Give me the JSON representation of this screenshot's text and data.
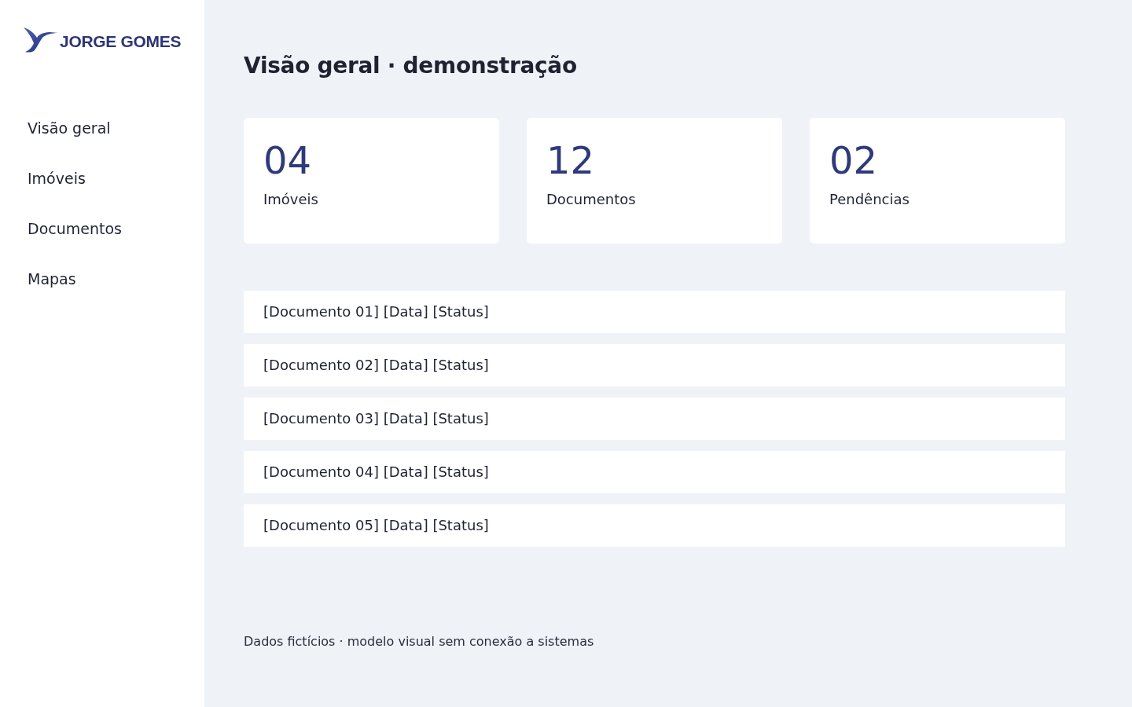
{
  "logo": {
    "text": "JORGE GOMES"
  },
  "sidebar": {
    "items": [
      {
        "label": "Visão geral"
      },
      {
        "label": "Imóveis"
      },
      {
        "label": "Documentos"
      },
      {
        "label": "Mapas"
      }
    ]
  },
  "page": {
    "title": "Visão geral · demonstração"
  },
  "stats": [
    {
      "value": "04",
      "label": "Imóveis"
    },
    {
      "value": "12",
      "label": "Documentos"
    },
    {
      "value": "02",
      "label": "Pendências"
    }
  ],
  "documents": [
    {
      "text": "[Documento 01] [Data] [Status]"
    },
    {
      "text": "[Documento 02] [Data] [Status]"
    },
    {
      "text": "[Documento 03] [Data] [Status]"
    },
    {
      "text": "[Documento 04] [Data] [Status]"
    },
    {
      "text": "[Documento 05] [Data] [Status]"
    }
  ],
  "footer": {
    "text": "Dados fictícios · modelo visual sem conexão a sistemas"
  }
}
